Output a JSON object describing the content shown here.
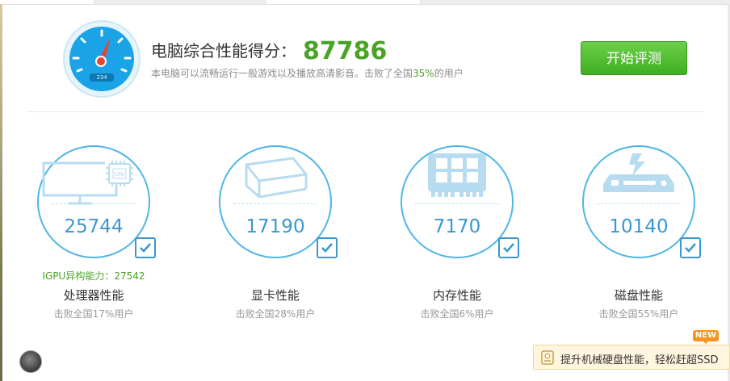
{
  "header": {
    "title": "电脑综合性能得分：",
    "score": "87786",
    "gauge_readout": "234",
    "desc_prefix": "本电脑可以流畅运行一般游戏以及播放高清影音。击败了全国",
    "desc_percent": "35%",
    "desc_suffix": "的用户",
    "start_button": "开始评测"
  },
  "cards": [
    {
      "icon": "monitor-cpu-icon",
      "value": "25744",
      "extra": "IGPU异构能力：27542",
      "label": "处理器性能",
      "sub": "击败全国17%用户"
    },
    {
      "icon": "cube-icon",
      "value": "17190",
      "label": "显卡性能",
      "sub": "击败全国28%用户"
    },
    {
      "icon": "memory-chip-icon",
      "value": "7170",
      "label": "内存性能",
      "sub": "击败全国6%用户"
    },
    {
      "icon": "hard-disk-icon",
      "value": "10140",
      "label": "磁盘性能",
      "sub": "击败全国55%用户"
    }
  ],
  "promo": {
    "badge": "NEW",
    "text": "提升机械硬盘性能，轻松赶超SSD"
  },
  "colors": {
    "accent_green": "#4aa327",
    "ring_blue": "#4eb6e6",
    "value_blue": "#3c97cc",
    "button_green": "#4cbf2c"
  }
}
